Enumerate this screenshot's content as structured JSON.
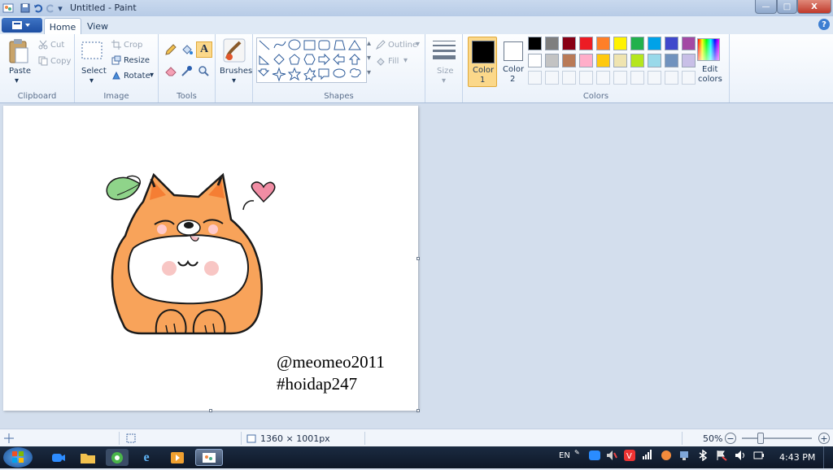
{
  "window": {
    "title": "Untitled - Paint",
    "controls": {
      "minimize": "—",
      "maximize": "□",
      "close": "X"
    }
  },
  "tabs": [
    {
      "label": "Home"
    },
    {
      "label": "View"
    }
  ],
  "groups": {
    "clipboard": {
      "label": "Clipboard",
      "paste": "Paste",
      "cut": "Cut",
      "copy": "Copy"
    },
    "image": {
      "label": "Image",
      "select": "Select",
      "crop": "Crop",
      "resize": "Resize",
      "rotate": "Rotate"
    },
    "tools": {
      "label": "Tools"
    },
    "brushes": {
      "label": "Brushes"
    },
    "shapes": {
      "label": "Shapes",
      "outline": "Outline",
      "fill": "Fill"
    },
    "size": {
      "label": "Size"
    },
    "colors": {
      "label": "Colors",
      "color1": "Color\n1",
      "color1_a": "Color",
      "color1_b": "1",
      "color2_a": "Color",
      "color2_b": "2",
      "edit_a": "Edit",
      "edit_b": "colors",
      "color1_value": "#000000",
      "color2_value": "#ffffff",
      "palette_row1": [
        "#000000",
        "#7f7f7f",
        "#880015",
        "#ed1c24",
        "#ff7f27",
        "#fff200",
        "#22b14c",
        "#00a2e8",
        "#3f48cc",
        "#a349a4"
      ],
      "palette_row2": [
        "#ffffff",
        "#c3c3c3",
        "#b97a57",
        "#ffaec9",
        "#ffc90e",
        "#efe4b0",
        "#b5e61d",
        "#99d9ea",
        "#7092be",
        "#c8bfe7"
      ]
    }
  },
  "canvas": {
    "line1": "@meomeo2011",
    "line2": "#hoidap247"
  },
  "status": {
    "dimensions": "1360 × 1001px",
    "zoom": "50%"
  },
  "taskbar": {
    "lang": "EN",
    "time": "4:43 PM"
  }
}
